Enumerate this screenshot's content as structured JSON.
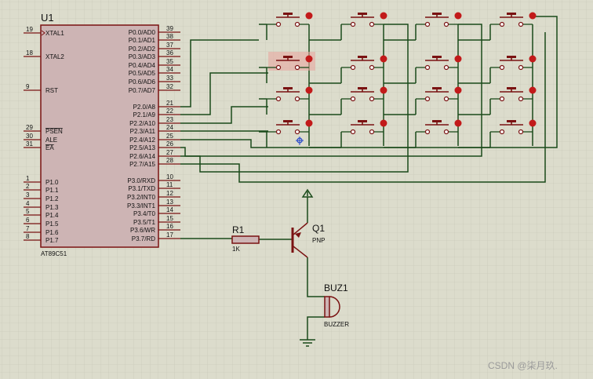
{
  "mcu": {
    "ref": "U1",
    "part": "AT89C51",
    "left_pins": [
      {
        "num": "19",
        "name": "XTAL1"
      },
      {
        "num": "18",
        "name": "XTAL2"
      },
      {
        "num": "9",
        "name": "RST"
      },
      {
        "num": "29",
        "name": "PSEN"
      },
      {
        "num": "30",
        "name": "ALE"
      },
      {
        "num": "31",
        "name": "EA"
      },
      {
        "num": "1",
        "name": "P1.0"
      },
      {
        "num": "2",
        "name": "P1.1"
      },
      {
        "num": "3",
        "name": "P1.2"
      },
      {
        "num": "4",
        "name": "P1.3"
      },
      {
        "num": "5",
        "name": "P1.4"
      },
      {
        "num": "6",
        "name": "P1.5"
      },
      {
        "num": "7",
        "name": "P1.6"
      },
      {
        "num": "8",
        "name": "P1.7"
      }
    ],
    "right_pins": [
      {
        "num": "39",
        "name": "P0.0/AD0"
      },
      {
        "num": "38",
        "name": "P0.1/AD1"
      },
      {
        "num": "37",
        "name": "P0.2/AD2"
      },
      {
        "num": "36",
        "name": "P0.3/AD3"
      },
      {
        "num": "35",
        "name": "P0.4/AD4"
      },
      {
        "num": "34",
        "name": "P0.5/AD5"
      },
      {
        "num": "33",
        "name": "P0.6/AD6"
      },
      {
        "num": "32",
        "name": "P0.7/AD7"
      },
      {
        "num": "21",
        "name": "P2.0/A8"
      },
      {
        "num": "22",
        "name": "P2.1/A9"
      },
      {
        "num": "23",
        "name": "P2.2/A10"
      },
      {
        "num": "24",
        "name": "P2.3/A11"
      },
      {
        "num": "25",
        "name": "P2.4/A12"
      },
      {
        "num": "26",
        "name": "P2.5/A13"
      },
      {
        "num": "27",
        "name": "P2.6/A14"
      },
      {
        "num": "28",
        "name": "P2.7/A15"
      },
      {
        "num": "10",
        "name": "P3.0/RXD"
      },
      {
        "num": "11",
        "name": "P3.1/TXD"
      },
      {
        "num": "12",
        "name": "P3.2/INT0"
      },
      {
        "num": "13",
        "name": "P3.3/INT1"
      },
      {
        "num": "14",
        "name": "P3.4/T0"
      },
      {
        "num": "15",
        "name": "P3.5/T1"
      },
      {
        "num": "16",
        "name": "P3.6/WR"
      },
      {
        "num": "17",
        "name": "P3.7/RD"
      }
    ]
  },
  "resistor": {
    "ref": "R1",
    "value": "1K"
  },
  "transistor": {
    "ref": "Q1",
    "type": "PNP"
  },
  "buzzer": {
    "ref": "BUZ1",
    "type": "BUZZER"
  },
  "keypad": {
    "rows": 4,
    "cols": 4,
    "selected_key": "row 2, column 1"
  },
  "watermark": "CSDN @柒月玖.",
  "colors": {
    "background": "#dcdccc",
    "grid": "#c4c4b4",
    "wire": "#1a4a1a",
    "component": "#7a1212",
    "ic_fill": "#cdb4b4",
    "highlight": "#e8a8a0"
  }
}
